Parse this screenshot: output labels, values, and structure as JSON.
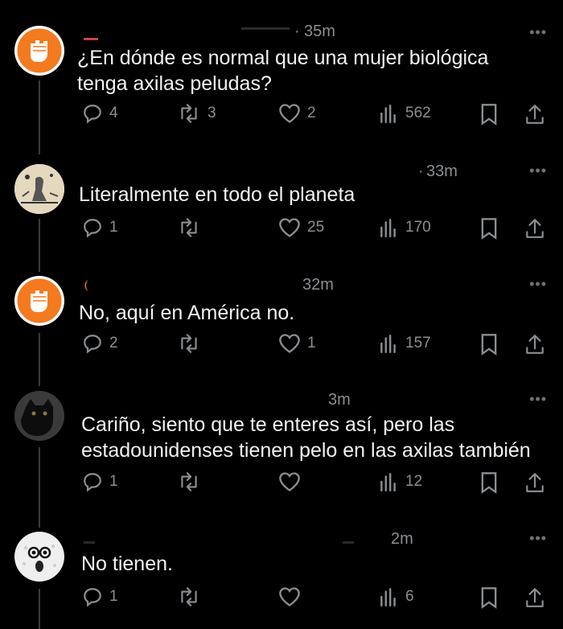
{
  "tweets": [
    {
      "avatar": "raised-fist",
      "time": "35m",
      "text": "¿En dónde es normal que una mujer biológica tenga axilas peludas?",
      "replies": "4",
      "reposts": "3",
      "likes": "2",
      "views": "562"
    },
    {
      "avatar": "illustration",
      "time": "33m",
      "text": "Literalmente en todo el planeta",
      "replies": "1",
      "reposts": "",
      "likes": "25",
      "views": "170"
    },
    {
      "avatar": "raised-fist",
      "time": "32m",
      "text": "No, aquí en América no.",
      "replies": "2",
      "reposts": "",
      "likes": "1",
      "views": "157"
    },
    {
      "avatar": "black-cat",
      "time": "3m",
      "text": "Cariño, siento que te enteres así, pero las estadounidenses tienen pelo en las axilas también",
      "replies": "1",
      "reposts": "",
      "likes": "",
      "views": "12"
    },
    {
      "avatar": "golf-ball-face",
      "time": "2m",
      "text": "No tienen.",
      "replies": "1",
      "reposts": "",
      "likes": "",
      "views": "6"
    }
  ],
  "more_label": "•••",
  "colors": {
    "background": "#000000",
    "text": "#e7e9ea",
    "muted": "#8b8f93",
    "orange": "#f47a20"
  }
}
